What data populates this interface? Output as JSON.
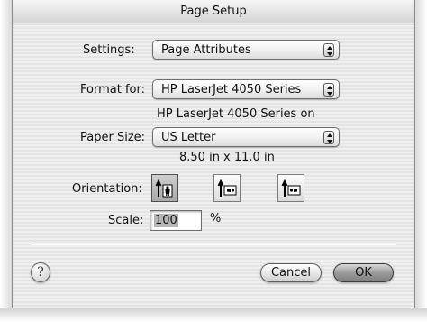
{
  "window": {
    "title": "Page Setup"
  },
  "settings": {
    "label": "Settings:",
    "value": "Page Attributes"
  },
  "format_for": {
    "label": "Format for:",
    "value": "HP LaserJet 4050 Series",
    "info": "HP LaserJet 4050 Series on"
  },
  "paper_size": {
    "label": "Paper Size:",
    "value": "US Letter",
    "dimensions": "8.50 in x 11.0 in"
  },
  "orientation": {
    "label": "Orientation:",
    "options": [
      {
        "name": "portrait",
        "selected": true
      },
      {
        "name": "landscape-left",
        "selected": false
      },
      {
        "name": "landscape-right",
        "selected": false
      }
    ]
  },
  "scale": {
    "label": "Scale:",
    "value": "100",
    "unit": "%"
  },
  "buttons": {
    "help": "?",
    "cancel": "Cancel",
    "ok": "OK"
  },
  "colors": {
    "ok_button": "#8c8c8c",
    "dialog_stripe_light": "#efefef",
    "dialog_stripe_dark": "#e4e4e4"
  }
}
